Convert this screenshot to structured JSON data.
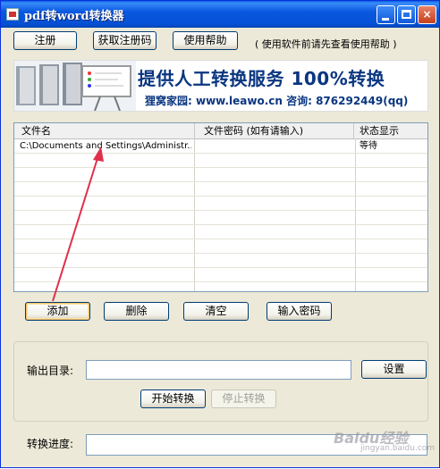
{
  "window": {
    "title": "pdf转word转换器",
    "controls": {
      "minimize": "minimize",
      "maximize": "maximize",
      "close": "×"
    }
  },
  "toolbar": {
    "register_label": "注册",
    "get_code_label": "获取注册码",
    "help_label": "使用帮助",
    "hint": "( 使用软件前请先查看使用帮助 )"
  },
  "banner": {
    "headline": "提供人工转换服务 100%转换",
    "subline": "狸窝家园: www.leawo.cn  咨询: 876292449(qq)"
  },
  "file_table": {
    "columns": [
      "文件名",
      "文件密码 (如有请输入)",
      "状态显示"
    ],
    "rows": [
      {
        "filename": "C:\\Documents and Settings\\Administr...",
        "password": "",
        "status": "等待"
      }
    ]
  },
  "actions": {
    "add_label": "添加",
    "delete_label": "删除",
    "clear_label": "清空",
    "password_label": "输入密码"
  },
  "output": {
    "dir_label": "输出目录:",
    "dir_value": "",
    "settings_label": "设置",
    "start_label": "开始转换",
    "stop_label": "停止转换"
  },
  "progress": {
    "label": "转换进度:",
    "value": 0
  },
  "watermark": {
    "text": "Baidu经验",
    "sub": "jingyan.baidu.com"
  },
  "colors": {
    "titlebar": "#0a58e0",
    "annotation_arrow": "#e0304a",
    "banner_text": "#0a3680"
  }
}
